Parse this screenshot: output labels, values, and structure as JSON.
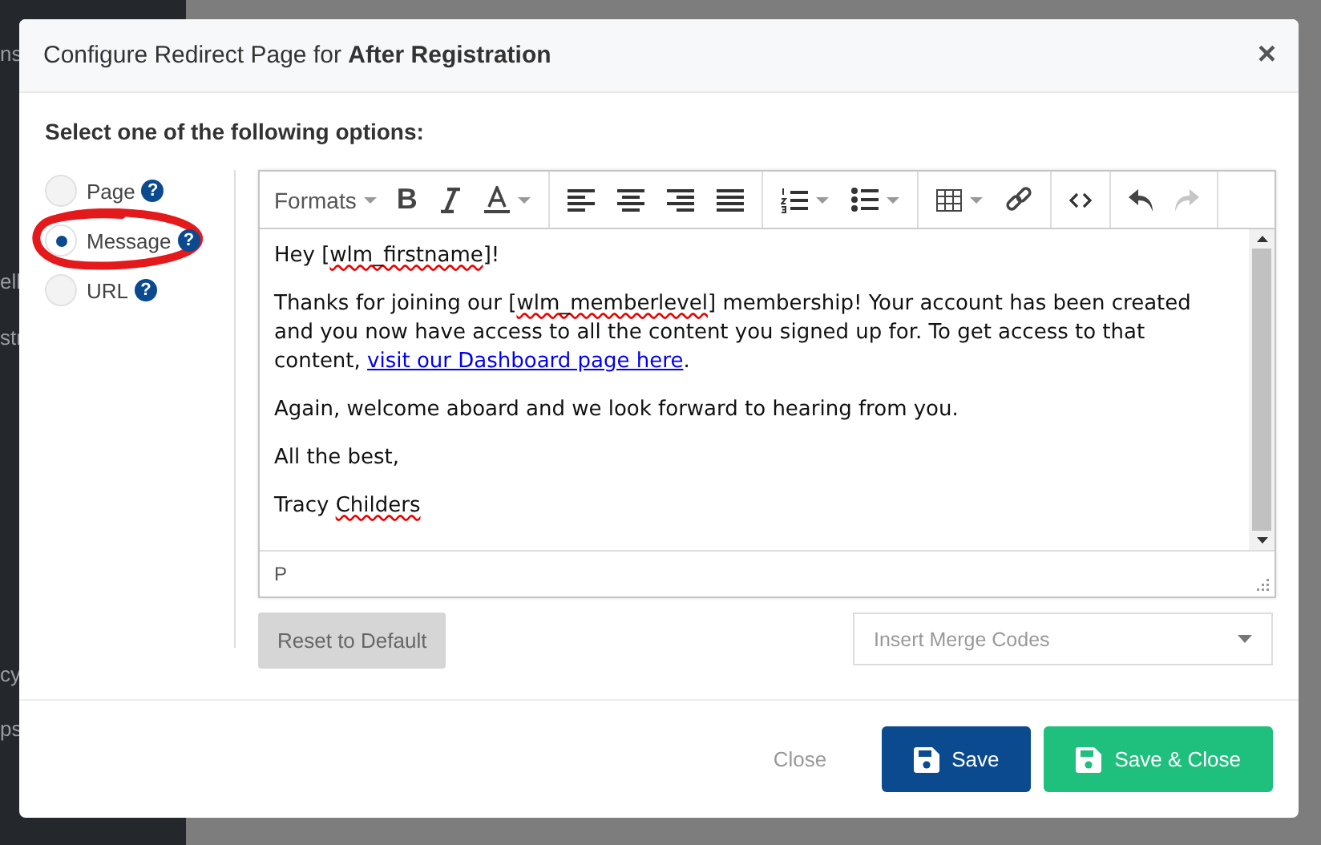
{
  "background": {
    "sidebar_items": [
      "ns",
      "ell",
      "str",
      "cy",
      "ps"
    ]
  },
  "dialog": {
    "title": "Configure Redirect Page for **After Registration**",
    "close": "×"
  },
  "prompt": "Select one of the following options:",
  "options": [
    {
      "label": "Page",
      "help": "?",
      "selected": false
    },
    {
      "label": "Message",
      "help": "?",
      "selected": true
    },
    {
      "label": "URL",
      "help": "?",
      "selected": false
    }
  ],
  "annotation": {
    "kind": "circle",
    "color": "#e4191c"
  },
  "editor": {
    "formats": "Formats",
    "toolbar": [
      {
        "kind": "bold",
        "label": "B",
        "disabled": false
      },
      {
        "kind": "italic",
        "disabled": false
      },
      {
        "kind": "textcolor",
        "disabled": false
      },
      {
        "kind": "sep"
      },
      {
        "kind": "alignleft",
        "disabled": false
      },
      {
        "kind": "aligncenter",
        "disabled": false
      },
      {
        "kind": "alignright",
        "disabled": false
      },
      {
        "kind": "justify",
        "disabled": false
      },
      {
        "kind": "sep"
      },
      {
        "kind": "numlist",
        "disabled": false
      },
      {
        "kind": "bullist",
        "disabled": false
      },
      {
        "kind": "sep"
      },
      {
        "kind": "table",
        "disabled": false
      },
      {
        "kind": "link",
        "disabled": false
      },
      {
        "kind": "sep"
      },
      {
        "kind": "code",
        "disabled": false
      },
      {
        "kind": "sep"
      },
      {
        "kind": "undo",
        "disabled": false
      },
      {
        "kind": "redo",
        "disabled": true
      }
    ],
    "paragraphs": [
      [
        {
          "kind": "plain",
          "text": "Hey ["
        },
        {
          "kind": "misspelled",
          "text": "wlm_firstname"
        },
        {
          "kind": "plain",
          "text": "]!"
        }
      ],
      [
        {
          "kind": "plain",
          "text": "Thanks for joining our ["
        },
        {
          "kind": "misspelled",
          "text": "wlm_memberlevel"
        },
        {
          "kind": "plain",
          "text": "] membership! Your account has been created and you now have access to all the content you signed up for. To get access to that content, "
        },
        {
          "kind": "link",
          "text": "visit our Dashboard page here"
        },
        {
          "kind": "plain",
          "text": "."
        }
      ],
      [
        {
          "kind": "plain",
          "text": "Again, welcome aboard and we look forward to hearing from you."
        }
      ],
      [
        {
          "kind": "plain",
          "text": "All the best,"
        }
      ],
      [
        {
          "kind": "plain",
          "text": "Tracy "
        },
        {
          "kind": "misspelled",
          "text": "Childers"
        }
      ]
    ],
    "path": "P"
  },
  "reset_button": {
    "label": "Reset to Default",
    "disabled": true
  },
  "merge_codes": {
    "placeholder": "Insert Merge Codes"
  },
  "footer": {
    "close": "Close",
    "save": "Save",
    "save_close": "Save & Close"
  }
}
